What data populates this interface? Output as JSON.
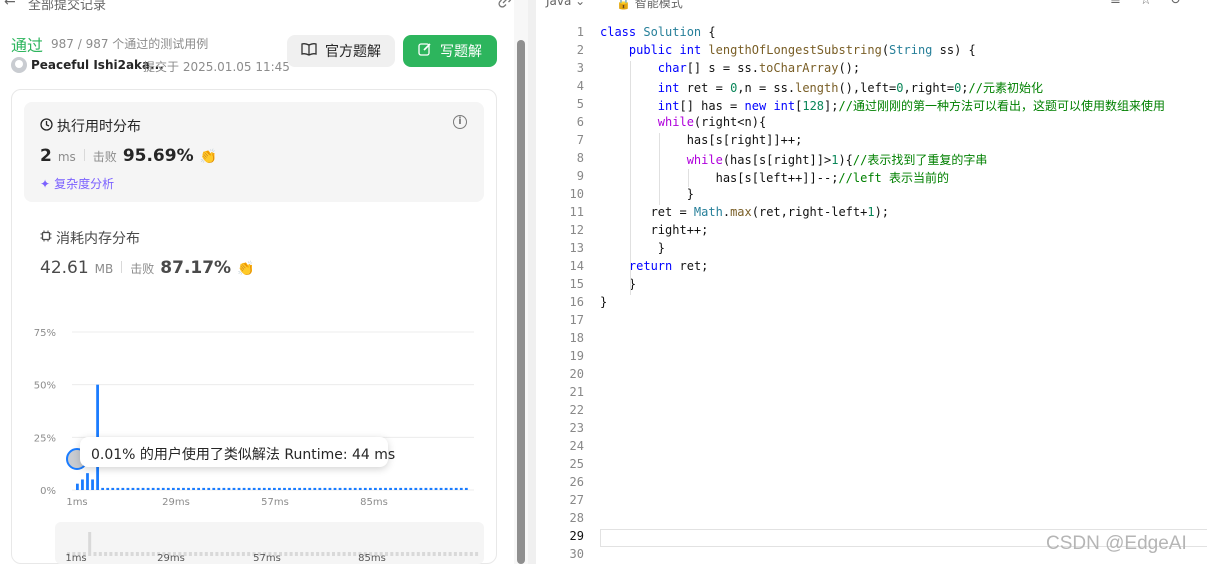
{
  "header": {
    "back_arrow": "←",
    "title": "全部提交记录",
    "link_icon_glyph": "🔗"
  },
  "submission": {
    "status": "通过",
    "passed_count": "987 / 987 个通过的测试用例",
    "username": "Peaceful Ishi2aka...",
    "submitted_at": "提交于 2025.01.05 11:45"
  },
  "actions": {
    "official_solution": "官方题解",
    "write_solution": "写题解"
  },
  "runtime": {
    "title": "执行用时分布",
    "value": "2",
    "unit": "ms",
    "beats_label": "击败",
    "beats_pct": "95.69%",
    "complexity_link": "复杂度分析"
  },
  "memory": {
    "title": "消耗内存分布",
    "value": "42.61",
    "unit": "MB",
    "beats_label": "击败",
    "beats_pct": "87.17%"
  },
  "tooltip": {
    "text": "0.01% 的用户使用了类似解法 Runtime: 44 ms"
  },
  "chart_data": {
    "type": "bar",
    "title": "",
    "xlabel": "",
    "ylabel": "",
    "y_ticks": [
      "75%",
      "50%",
      "25%",
      "0%"
    ],
    "x_ticks": [
      "1ms",
      "29ms",
      "57ms",
      "85ms"
    ],
    "ylim": [
      0,
      75
    ],
    "grid": true,
    "values": [
      3,
      5,
      8,
      5,
      50,
      1,
      1,
      1,
      1,
      1,
      1,
      1,
      1,
      1,
      1,
      1,
      1,
      1,
      1,
      1,
      1,
      1,
      1,
      1,
      1,
      1,
      1,
      1,
      1,
      1,
      1,
      1,
      1,
      1,
      1,
      1,
      1,
      1,
      1,
      1,
      1,
      1,
      1,
      1,
      1,
      1,
      1,
      1,
      1,
      1,
      1,
      1,
      1,
      1,
      1,
      1,
      1,
      1,
      1,
      1,
      1,
      1,
      1,
      1,
      1,
      1,
      1,
      1,
      1,
      1,
      1,
      1,
      1,
      1,
      1,
      1,
      1,
      1
    ],
    "highlight_color": "#1a7cff",
    "bar_color": "#1a7cff"
  },
  "minimap": {
    "x_ticks": [
      "1ms",
      "29ms",
      "57ms",
      "85ms"
    ]
  },
  "editor": {
    "language": "Java",
    "mode": "智能模式",
    "line_count": 30,
    "active_line": 29,
    "watermark": "CSDN @EdgeAI",
    "lines": [
      "class Solution {",
      "    public int lengthOfLongestSubstring(String ss) {",
      "        char[] s = ss.toCharArray();",
      "        int ret = 0,n = ss.length(),left=0,right=0;//元素初始化",
      "        int[] has = new int[128];//通过刚刚的第一种方法可以看出，这题可以使用数组来使用",
      "        while(right<n){",
      "            has[s[right]]++;",
      "            while(has[s[right]]>1){//表示找到了重复的字串",
      "                has[s[left++]]--;//left 表示当前的",
      "            }",
      "       ret = Math.max(ret,right-left+1);",
      "       right++;",
      "        }",
      "    return ret;",
      "    }",
      "}"
    ]
  },
  "colors": {
    "accent_green": "#2db55d",
    "accent_blue": "#1a7cff",
    "purple": "#7b61ff"
  }
}
